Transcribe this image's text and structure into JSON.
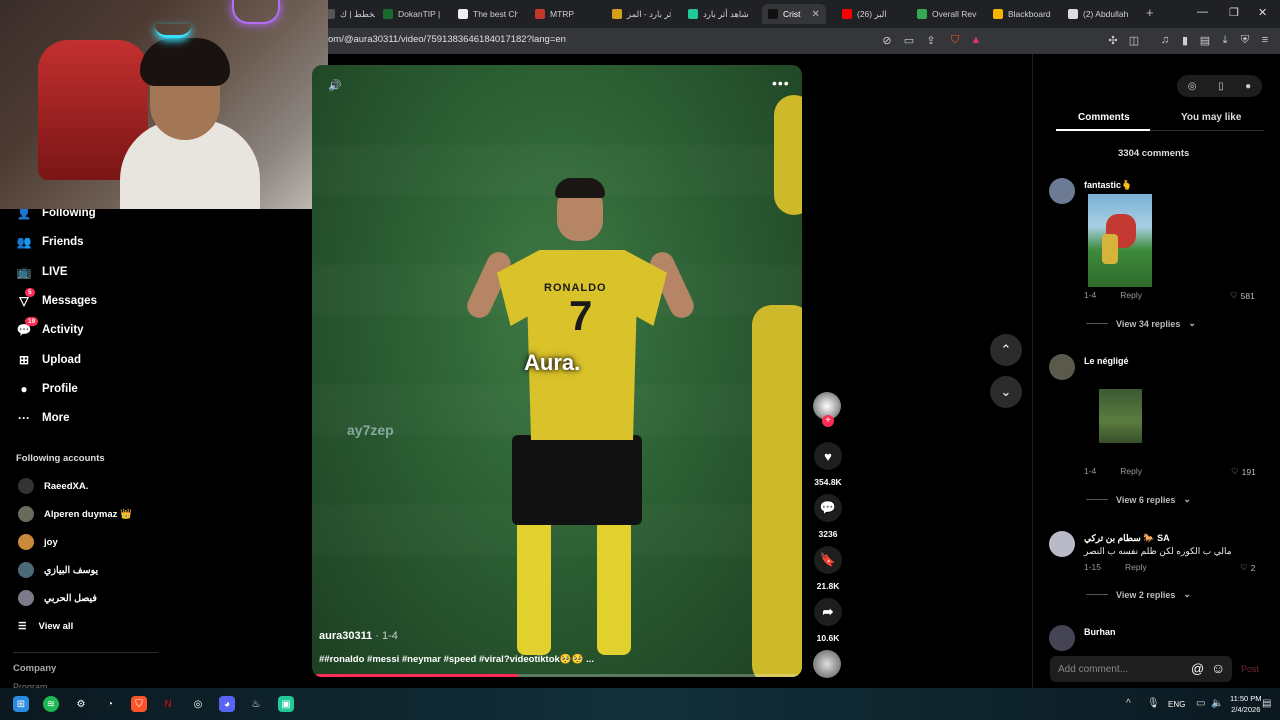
{
  "browser": {
    "tabs": [
      {
        "label": "المخطط | ك",
        "color": "#555"
      },
      {
        "label": "DokanTIP |",
        "color": "#1b6b2f"
      },
      {
        "label": "The best Ch",
        "color": "#eeeeee"
      },
      {
        "label": "MTRP",
        "color": "#c0392b"
      },
      {
        "label": "أثر بارد - المز",
        "color": "#d4a017"
      },
      {
        "label": "شاهد أثر بارد",
        "color": "#20c997"
      },
      {
        "label": "Crist",
        "color": "#111111",
        "active": true
      },
      {
        "label": "(26) البر",
        "color": "#ff0000"
      },
      {
        "label": "Overall Revi",
        "color": "#34a853"
      },
      {
        "label": "Blackboard",
        "color": "#f4b400"
      },
      {
        "label": "(2) Abdullah",
        "color": "#dddddd"
      }
    ],
    "url": "om/@aura30311/video/7591383646184017182?lang=en",
    "window_controls": {
      "minimize": "—",
      "restore": "❐",
      "close": "✕"
    },
    "new_tab": "+"
  },
  "sidebar": {
    "nav": [
      {
        "label": "Following",
        "icon": "following-icon"
      },
      {
        "label": "Friends",
        "icon": "friends-icon"
      },
      {
        "label": "LIVE",
        "icon": "live-icon"
      },
      {
        "label": "Messages",
        "icon": "messages-icon",
        "badge": "5"
      },
      {
        "label": "Activity",
        "icon": "activity-icon",
        "badge": "19"
      },
      {
        "label": "Upload",
        "icon": "upload-icon"
      },
      {
        "label": "Profile",
        "icon": "profile-icon"
      },
      {
        "label": "More",
        "icon": "more-icon"
      }
    ],
    "following_accounts_title": "Following accounts",
    "accounts": [
      "RaeedXA.",
      "Alperen duymaz 👑",
      "joy",
      "يوسف البيازي",
      "فيصل الحربي"
    ],
    "view_all": "View all",
    "company": "Company",
    "program": "Program"
  },
  "video": {
    "jersey_name": "RONALDO",
    "jersey_number": "7",
    "overlay_text": "Aura.",
    "watermark": "ay7zep",
    "author": "aura30311",
    "date": " · 1-4",
    "caption": "##ronaldo #messi #neymar #speed #viral?videotiktok🥺🥺 ...",
    "progress": 0.42
  },
  "actions": {
    "likes": "354.8K",
    "comments": "3236",
    "saves": "21.8K",
    "shares": "10.6K"
  },
  "panel": {
    "tab_comments": "Comments",
    "tab_you_may_like": "You may like",
    "comment_count": "3304 comments",
    "comments": [
      {
        "user": "fantastic🫰",
        "text": "",
        "date": "1-4",
        "reply": "Reply",
        "likes": "581",
        "view_replies": "View 34 replies"
      },
      {
        "user": "Le négligé",
        "text": "",
        "date": "1-4",
        "reply": "Reply",
        "likes": "191",
        "view_replies": "View 6 replies"
      },
      {
        "user": "سطام بن تركي 🐎 SA",
        "text": "مالي ب الكوره لكن ظلم نفسه ب النصر",
        "date": "1-15",
        "reply": "Reply",
        "likes": "2",
        "view_replies": "View 2 replies"
      },
      {
        "user": "Burhan",
        "text": "",
        "date": "",
        "reply": "",
        "likes": "",
        "view_replies": ""
      }
    ],
    "add_comment_placeholder": "Add comment...",
    "post": "Post"
  },
  "taskbar": {
    "lang": "ENG",
    "time": "11:50 PM",
    "date": "2/4/2026"
  }
}
